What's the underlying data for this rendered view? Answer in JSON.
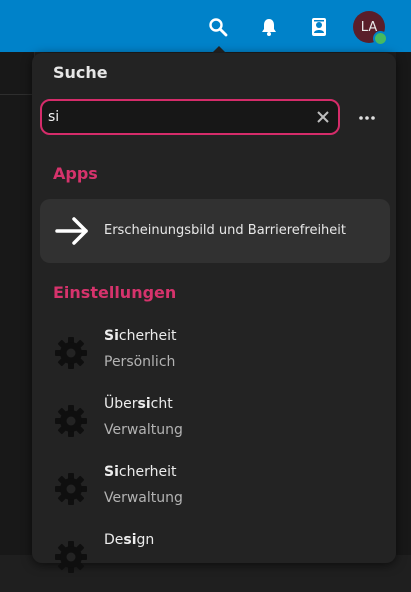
{
  "header": {
    "avatar_initials": "LA",
    "status_color": "#46ba61",
    "icons": [
      "search-icon",
      "bell-icon",
      "contacts-icon"
    ]
  },
  "panel": {
    "title": "Suche",
    "search": {
      "value": "si"
    },
    "sections": {
      "apps_title": "Apps",
      "settings_title": "Einstellungen"
    },
    "app_result": {
      "label": "Erscheinungsbild und Barrierefreiheit",
      "icon": "arrow-right-icon"
    },
    "settings_results": [
      {
        "title_pre": "",
        "title_match": "Si",
        "title_post": "cherheit",
        "subtitle": "Persönlich"
      },
      {
        "title_pre": "Über",
        "title_match": "si",
        "title_post": "cht",
        "subtitle": "Verwaltung"
      },
      {
        "title_pre": "",
        "title_match": "Si",
        "title_post": "cherheit",
        "subtitle": "Verwaltung"
      },
      {
        "title_pre": "De",
        "title_match": "si",
        "title_post": "gn",
        "subtitle": ""
      }
    ]
  },
  "colors": {
    "topbar": "#0082c9",
    "accent": "#d6336c",
    "panel": "#232323"
  }
}
